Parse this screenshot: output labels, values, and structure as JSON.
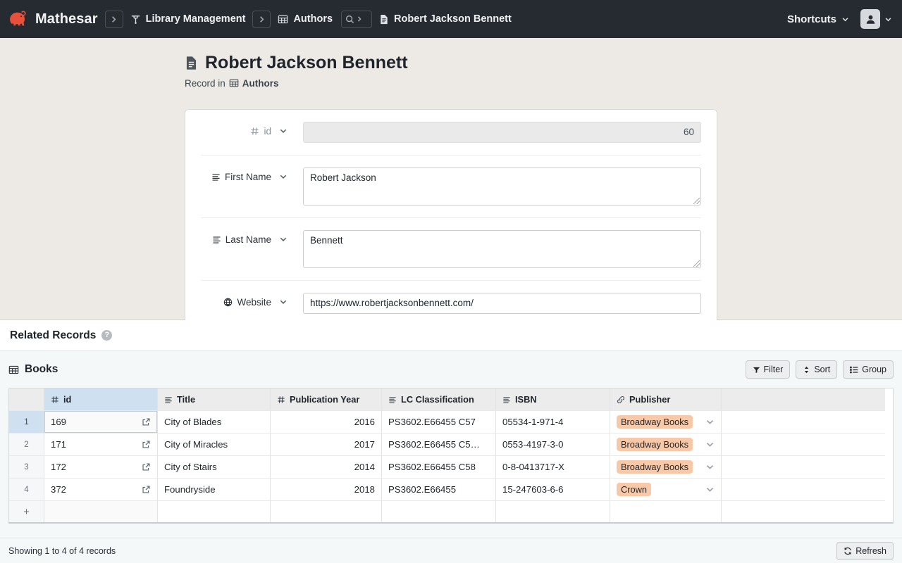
{
  "topbar": {
    "brand_name": "Mathesar",
    "brand_logo_icon": "elephant-logo",
    "breadcrumbs": [
      {
        "label": "Library Management",
        "icon": "database-icon"
      },
      {
        "label": "Authors",
        "icon": "table-icon"
      },
      {
        "label": "Robert Jackson Bennett",
        "icon": "record-icon"
      }
    ],
    "search_icon": "search-icon",
    "search_chevron_icon": "chevron-right-icon",
    "separator_icon": "chevron-right-icon",
    "shortcuts_label": "Shortcuts",
    "shortcuts_chevron_icon": "chevron-down-icon",
    "user_icon": "user-avatar-icon",
    "user_chevron_icon": "chevron-down-icon"
  },
  "record": {
    "title": "Robert Jackson Bennett",
    "title_icon": "record-icon",
    "subtitle_prefix": "Record in",
    "subtitle_table": "Authors",
    "subtitle_icon": "table-icon",
    "fields": [
      {
        "label": "id",
        "type_icon": "number-icon",
        "chevron_icon": "chevron-down-icon",
        "value": "60",
        "control": "input",
        "disabled": true,
        "align": "right"
      },
      {
        "label": "First Name",
        "type_icon": "text-icon",
        "chevron_icon": "chevron-down-icon",
        "value": "Robert Jackson",
        "control": "textarea",
        "disabled": false,
        "align": "left"
      },
      {
        "label": "Last Name",
        "type_icon": "text-icon",
        "chevron_icon": "chevron-down-icon",
        "value": "Bennett",
        "control": "textarea",
        "disabled": false,
        "align": "left"
      },
      {
        "label": "Website",
        "type_icon": "globe-icon",
        "chevron_icon": "chevron-down-icon",
        "value": "https://www.robertjacksonbennett.com/",
        "control": "input",
        "disabled": false,
        "align": "left"
      }
    ]
  },
  "related": {
    "heading": "Related Records",
    "help_icon": "question-mark-icon",
    "help_label": "?"
  },
  "table": {
    "name": "Books",
    "name_icon": "table-icon",
    "actions": [
      {
        "label": "Filter",
        "icon": "filter-icon"
      },
      {
        "label": "Sort",
        "icon": "sort-icon"
      },
      {
        "label": "Group",
        "icon": "group-icon"
      }
    ],
    "columns": [
      {
        "label": "id",
        "icon": "number-icon",
        "selected": true
      },
      {
        "label": "Title",
        "icon": "text-icon",
        "selected": false
      },
      {
        "label": "Publication Year",
        "icon": "number-icon",
        "selected": false
      },
      {
        "label": "LC Classification",
        "icon": "text-icon",
        "selected": false
      },
      {
        "label": "ISBN",
        "icon": "text-icon",
        "selected": false
      },
      {
        "label": "Publisher",
        "icon": "link-icon",
        "selected": false
      }
    ],
    "rows": [
      {
        "number": "1",
        "id": "169",
        "title": "City of Blades",
        "publication_year": "2016",
        "lc_classification": "PS3602.E66455 C57",
        "isbn": "05534-1-971-4",
        "publisher": "Broadway Books",
        "selected": true,
        "link_icon": "external-link-icon",
        "publisher_chevron_icon": "chevron-down-icon"
      },
      {
        "number": "2",
        "id": "171",
        "title": "City of Miracles",
        "publication_year": "2017",
        "lc_classification": "PS3602.E66455 C5…",
        "isbn": "0553-4197-3-0",
        "publisher": "Broadway Books",
        "selected": false,
        "link_icon": "external-link-icon",
        "publisher_chevron_icon": "chevron-down-icon"
      },
      {
        "number": "3",
        "id": "172",
        "title": "City of Stairs",
        "publication_year": "2014",
        "lc_classification": "PS3602.E66455 C58",
        "isbn": "0-8-0413717-X",
        "publisher": "Broadway Books",
        "selected": false,
        "link_icon": "external-link-icon",
        "publisher_chevron_icon": "chevron-down-icon"
      },
      {
        "number": "4",
        "id": "372",
        "title": "Foundryside",
        "publication_year": "2018",
        "lc_classification": "PS3602.E66455",
        "isbn": "15-247603-6-6",
        "publisher": "Crown",
        "selected": false,
        "link_icon": "external-link-icon",
        "publisher_chevron_icon": "chevron-down-icon"
      }
    ],
    "add_row_label": "+",
    "add_row_icon": "plus-icon"
  },
  "footer": {
    "status": "Showing 1 to 4 of 4 records",
    "refresh_label": "Refresh",
    "refresh_icon": "refresh-icon"
  },
  "colors": {
    "topbar_bg": "#262b31",
    "brand_accent": "#e8503a",
    "record_area_bg": "#edeae6",
    "table_panel_bg": "#f5f8f9",
    "selection_blue": "#cfe0f0",
    "pill_peach": "#f7c9a8"
  }
}
